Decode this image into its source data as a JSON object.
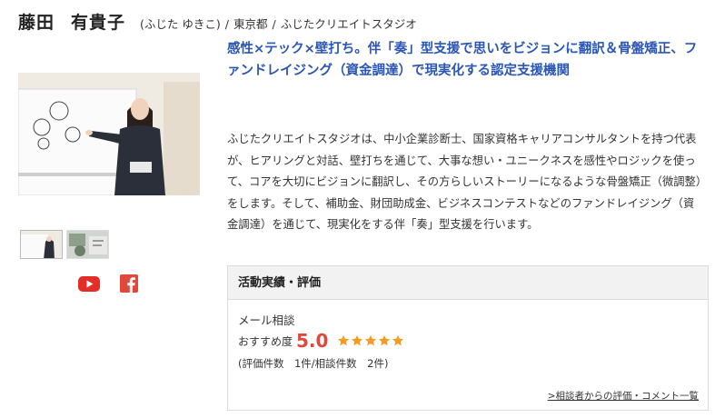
{
  "profile": {
    "surname": "藤田",
    "given_name": "有貴子",
    "reading": "(ふじた ゆきこ)",
    "location": "東京都",
    "company": "ふじたクリエイトスタジオ"
  },
  "gallery": {
    "main_alt": "presenter-at-whiteboard",
    "thumbs": [
      "thumb-presenter",
      "thumb-workspace"
    ]
  },
  "social": [
    {
      "name": "youtube-icon",
      "color": "#e52d27"
    },
    {
      "name": "facebook-icon",
      "color": "#e0483a"
    }
  ],
  "headline": "感性×テック×壁打ち。伴「奏」型支援で思いをビジョンに翻訳＆骨盤矯正、ファンドレイジング（資金調達）で現実化する認定支援機関",
  "description": "ふじたクリエイトスタジオは、中小企業診断士、国家資格キャリアコンサルタントを持つ代表が、ヒアリングと対話、壁打ちを通じて、大事な想い・ユニークネスを感性やロジックを使って、コアを大切にビジョンに翻訳し、その方らしいストーリーになるような骨盤矯正（微調整）をします。そして、補助金、財団助成金、ビジネスコンテストなどのファンドレイジング（資金調達）を通じて、現実化をする伴「奏」型支援を行います。",
  "evaluation": {
    "title": "活動実績・評価",
    "type": "メール相談",
    "recommend_label": "おすすめ度",
    "score": "5.0",
    "stars": 5,
    "counts": "(評価件数　1件/相談件数　2件)",
    "link": ">相談者からの評価・コメント一覧",
    "star_color": "#f39c1f"
  },
  "accent": "#2b56b3"
}
